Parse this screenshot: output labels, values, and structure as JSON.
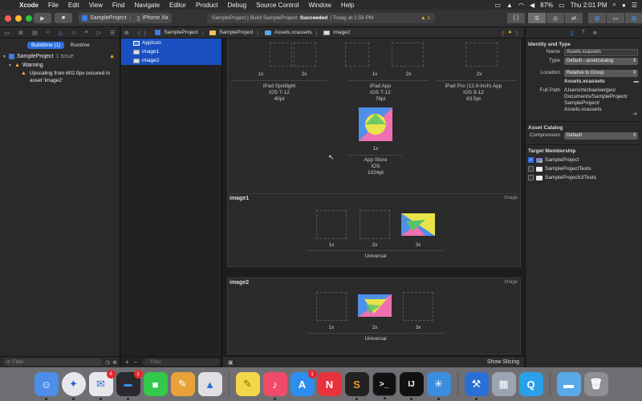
{
  "menubar": {
    "app": "Xcode",
    "items": [
      "File",
      "Edit",
      "View",
      "Find",
      "Navigate",
      "Editor",
      "Product",
      "Debug",
      "Source Control",
      "Window",
      "Help"
    ],
    "battery": "87%",
    "clock": "Thu 2:01 PM"
  },
  "toolbar": {
    "scheme": "SampleProject",
    "device": "iPhone Xʀ",
    "status_prefix": "SampleProject | Build SampleProject:",
    "status_result": "Succeeded",
    "status_time": "| Today at 1:59 PM",
    "warning_count": "1"
  },
  "navigator": {
    "tab_buildtime": "Buildtime (1)",
    "tab_runtime": "Runtime",
    "project": "SampleProject",
    "project_issues": "1 issue",
    "warning_group": "Warning",
    "warning_line1": "Upscaling from 602.0px occured in",
    "warning_line2": "asset 'image2'",
    "filter_placeholder": "Filter"
  },
  "jumpbar": {
    "crumbs": [
      "SampleProject",
      "SampleProject",
      "Assets.xcassets",
      "image2"
    ]
  },
  "assets": {
    "items": [
      "AppIcon",
      "image1",
      "image2"
    ],
    "filter_placeholder": "Filter"
  },
  "appicon": {
    "slot_labels": [
      "1x",
      "2x",
      "1x",
      "2x",
      "2x"
    ],
    "captions": [
      [
        "iPad Spotlight",
        "iOS 7-12",
        "40pt"
      ],
      [
        "iPad App",
        "iOS 7-12",
        "76pt"
      ],
      [
        "iPad Pro (12.9-inch) App",
        "iOS 9-12",
        "83.5pt"
      ]
    ],
    "store_label": "1x",
    "store_caption": [
      "App Store",
      "iOS",
      "1024pt"
    ]
  },
  "image1": {
    "title": "image1",
    "kind": "Image",
    "scales": [
      "1x",
      "2x",
      "3x"
    ],
    "caption": "Universal"
  },
  "image2": {
    "title": "image2",
    "kind": "Image",
    "scales": [
      "1x",
      "2x",
      "3x"
    ],
    "caption": "Universal"
  },
  "canvas_footer": {
    "show_slicing": "Show Slicing"
  },
  "inspector": {
    "identity_title": "Identity and Type",
    "name_label": "Name",
    "name_value": "Assets.xcassets",
    "type_label": "Type",
    "type_value": "Default - assetcatalog",
    "location_label": "Location",
    "location_value": "Relative to Group",
    "location_file": "Assets.xcassets",
    "fullpath_label": "Full Path",
    "fullpath_lines": [
      "/Users/michaelverges/",
      "Documents/SampleProject/",
      "SampleProject/",
      "Assets.xcassets"
    ],
    "catalog_title": "Asset Catalog",
    "compression_label": "Compression",
    "compression_value": "Default",
    "membership_title": "Target Membership",
    "targets": [
      "SampleProject",
      "SampleProjectTests",
      "SampleProjectUITests"
    ]
  },
  "dock": {
    "mail_badge": "4",
    "app3_badge": "1",
    "appstore_badge": "1"
  },
  "colors": {
    "selection": "#1a4fbf",
    "accent": "#2e6fe0",
    "warning": "#f0b429"
  }
}
